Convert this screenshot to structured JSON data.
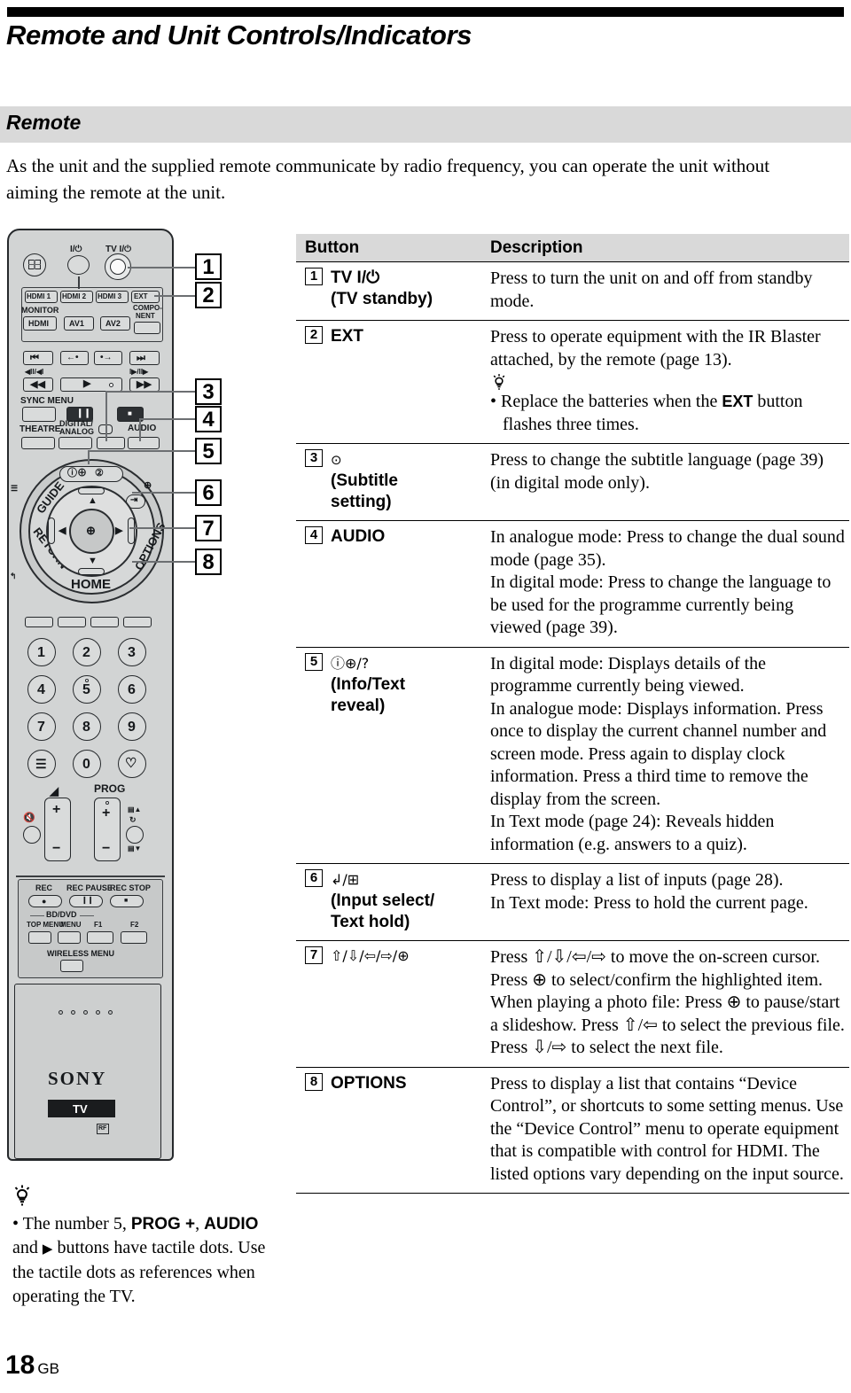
{
  "page": {
    "title": "Remote and Unit Controls/Indicators",
    "section_heading": "Remote",
    "intro": "As the unit and the supplied remote communicate by radio frequency, you can operate the unit without aiming the remote at the unit.",
    "page_number": "18",
    "page_region": "GB"
  },
  "table": {
    "headers": {
      "button": "Button",
      "description": "Description"
    },
    "rows": [
      {
        "num": "1",
        "button_line1": "TV I/⏻",
        "button_line2": "(TV standby)",
        "description": "Press to turn the unit on and off from standby mode."
      },
      {
        "num": "2",
        "button_line1": "EXT",
        "button_line2": "",
        "description": "Press to operate equipment with the IR Blaster attached, by the remote (page 13).",
        "tip_bullet_pre": "• Replace the batteries when the ",
        "tip_bullet_bold": "EXT",
        "tip_bullet_post": " button flashes three times."
      },
      {
        "num": "3",
        "button_line1": "⊙",
        "button_line2": "(Subtitle setting)",
        "description": "Press to change the subtitle language (page 39) (in digital mode only)."
      },
      {
        "num": "4",
        "button_line1": "AUDIO",
        "button_line2": "",
        "description": "In analogue mode: Press to change the dual sound mode (page 35). In digital mode: Press to change the language to be used for the programme currently being viewed (page 39).",
        "description_lines": [
          "In analogue mode: Press to change the dual sound mode (page 35).",
          "In digital mode: Press to change the language to be used for the programme currently being viewed (page 39)."
        ]
      },
      {
        "num": "5",
        "button_line1": "ⓘ⊕/?",
        "button_line2": "(Info/Text reveal)",
        "description_lines": [
          "In digital mode: Displays details of the programme currently being viewed.",
          "In analogue mode: Displays information. Press once to display the current channel number and screen mode. Press again to display clock information. Press a third time to remove the display from the screen.",
          "In Text mode (page 24): Reveals hidden information (e.g. answers to a quiz)."
        ]
      },
      {
        "num": "6",
        "button_line1": "↲/⊞",
        "button_line2": "(Input select/ Text hold)",
        "description_lines": [
          "Press to display a list of inputs (page 28).",
          "In Text mode: Press to hold the current page."
        ]
      },
      {
        "num": "7",
        "button_line1": "⇧/⇩/⇦/⇨/⊕",
        "button_line2": "",
        "description": "Press ⇧/⇩/⇦/⇨ to move the on-screen cursor. Press ⊕ to select/confirm the highlighted item. When playing a photo file: Press ⊕ to pause/start a slideshow. Press ⇧/⇦ to select the previous file. Press ⇩/⇨ to select the next file."
      },
      {
        "num": "8",
        "button_line1": "OPTIONS",
        "button_line2": "",
        "description": "Press to display a list that contains “Device Control”, or shortcuts to some setting menus. Use the “Device Control” menu to operate equipment that is compatible with control for HDMI. The listed options vary depending on the input source."
      }
    ]
  },
  "remote": {
    "callouts": [
      "1",
      "2",
      "3",
      "4",
      "5",
      "6",
      "7",
      "8"
    ],
    "top_labels": {
      "power": "I/⏻",
      "tv_power": "TV I/⏻"
    },
    "input_row": [
      "HDMI 1",
      "HDMI 2",
      "HDMI 3",
      "EXT"
    ],
    "input_row2": [
      "MONITOR",
      "HDMI",
      "AV1",
      "AV2",
      "COMPO-",
      "NENT"
    ],
    "transport_labels": [
      "⏮",
      "←•",
      "•→",
      "⏭",
      "◀II/◀I",
      "I▶/II▶",
      "◀◀",
      "▶",
      "▶▶"
    ],
    "sync_menu": "SYNC MENU",
    "theatre": "THEATRE",
    "digital_analog_l1": "DIGITAL/",
    "digital_analog_l2": "ANALOG",
    "audio": "AUDIO",
    "ring_labels": {
      "guide": "GUIDE",
      "return": "RETURN",
      "home": "HOME",
      "options": "OPTIONS"
    },
    "numpad": [
      "1",
      "2",
      "3",
      "4",
      "5",
      "6",
      "7",
      "8",
      "9",
      "☰",
      "0",
      "♡"
    ],
    "volume_label": "◢",
    "prog_label": "PROG",
    "plus": "+",
    "minus": "−",
    "rec_labels": [
      "REC",
      "REC PAUSE",
      "REC STOP"
    ],
    "bd_dvd": "BD/DVD",
    "bd_dvd_row": [
      "TOP MENU",
      "MENU",
      "F1",
      "F2"
    ],
    "wireless_menu": "WIRELESS MENU",
    "brand": "SONY",
    "mode_badge": "TV",
    "rf_badge": "RF"
  },
  "tip": {
    "text_pre": "• The number 5, ",
    "bold1": "PROG +",
    "mid1": ", ",
    "bold2": "AUDIO",
    "mid2": " and ",
    "play_glyph": "▶",
    "text_post": " buttons have tactile dots. Use the tactile dots as references when operating the TV."
  },
  "colors": {
    "band": "#d9d9d9",
    "remote_body": "#d2d4d4",
    "ink": "#000000"
  }
}
